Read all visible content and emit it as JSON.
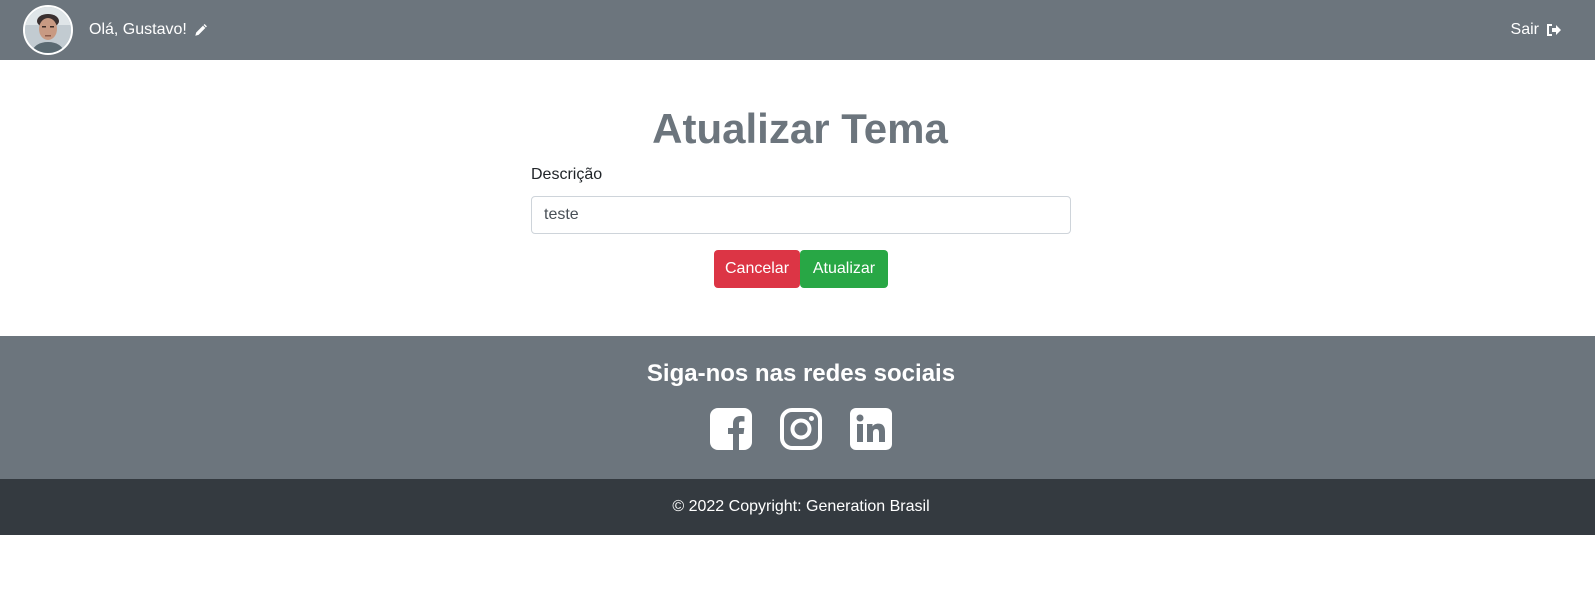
{
  "navbar": {
    "greeting": "Olá, Gustavo!",
    "logout_label": "Sair",
    "icons": {
      "avatar": "user-avatar-photo",
      "edit": "pencil-icon",
      "logout": "sign-out-icon"
    }
  },
  "form": {
    "title": "Atualizar Tema",
    "description_label": "Descrição",
    "description_value": "teste",
    "cancel_label": "Cancelar",
    "update_label": "Atualizar"
  },
  "footer": {
    "social_title": "Siga-nos nas redes sociais",
    "social_icons": [
      "facebook-icon",
      "instagram-icon",
      "linkedin-icon"
    ],
    "copyright": "© 2022 Copyright: Generation Brasil"
  },
  "colors": {
    "navbar_bg": "#6c757d",
    "footer_bottom_bg": "#343a40",
    "cancel_button": "#dc3545",
    "update_button": "#28a745",
    "title_color": "#6c757d"
  }
}
